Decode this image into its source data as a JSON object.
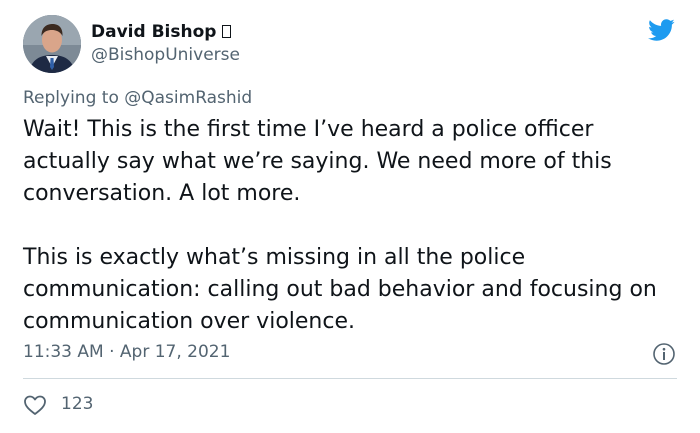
{
  "author": {
    "name": "David Bishop",
    "handle": "@BishopUniverse"
  },
  "reply": {
    "prefix": "Replying to ",
    "mention": "@QasimRashid"
  },
  "tweet": {
    "paragraph_1": "Wait! This is the first time I’ve heard a police officer actually say what we’re saying. We need more of this conversation. A lot more.",
    "paragraph_2": "This is exactly what’s missing in all the police communication: calling out bad behavior and focusing on communication over violence.",
    "timestamp": "11:33 AM · Apr 17, 2021"
  },
  "actions": {
    "like_count": "123"
  },
  "icons": {
    "brand": "twitter-bird-icon",
    "info": "info-icon",
    "like": "heart-icon"
  },
  "colors": {
    "brand": "#1d9bf0",
    "text": "#0f1419",
    "secondary": "#536471",
    "divider": "#cfd9de"
  }
}
